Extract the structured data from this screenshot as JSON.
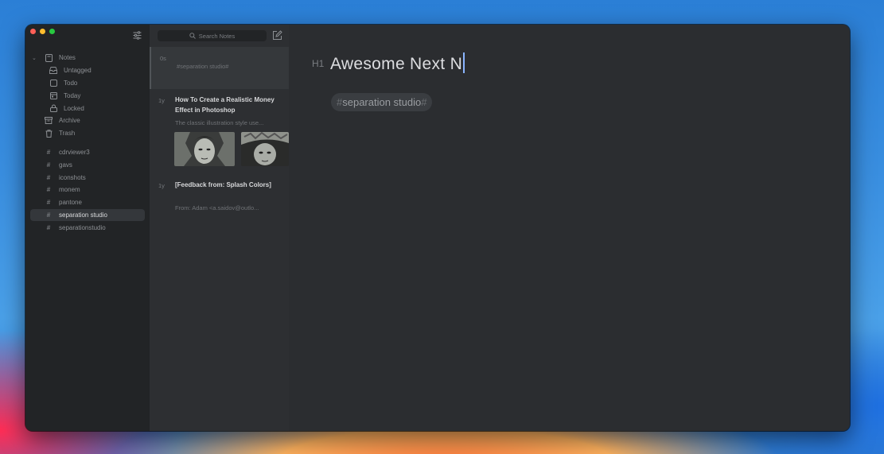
{
  "sidebar": {
    "notes_label": "Notes",
    "items": [
      {
        "label": "Untagged",
        "icon": "tray-icon"
      },
      {
        "label": "Todo",
        "icon": "checkbox-icon"
      },
      {
        "label": "Today",
        "icon": "calendar-icon"
      },
      {
        "label": "Locked",
        "icon": "lock-icon"
      }
    ],
    "archive_label": "Archive",
    "trash_label": "Trash",
    "tags": [
      "cdrviewer3",
      "gavs",
      "iconshots",
      "monem",
      "pantone",
      "separation studio",
      "separationstudio"
    ],
    "selected_tag": "separation studio"
  },
  "notes_list": {
    "search_placeholder": "Search Notes",
    "notes": [
      {
        "age": "0s",
        "title": "",
        "excerpt": "#separation studio#"
      },
      {
        "age": "1y",
        "title": "How To Create a Realistic Money Effect in Photoshop",
        "excerpt": "The classic illustration style use..."
      },
      {
        "age": "1y",
        "title": "[Feedback from: Splash Colors]",
        "excerpt": "From: Adam <a.saidov@outlo..."
      }
    ]
  },
  "editor": {
    "heading_marker": "H1",
    "title": "Awesome Next N",
    "tag_hash": "#",
    "tag_text": "separation studio"
  },
  "colors": {
    "window_bg": "#2b2d30",
    "sidebar_bg": "#222426",
    "notes_bg": "#2d2f32",
    "close": "#ff5f57",
    "minimize": "#febc2e",
    "zoom": "#28c840"
  }
}
